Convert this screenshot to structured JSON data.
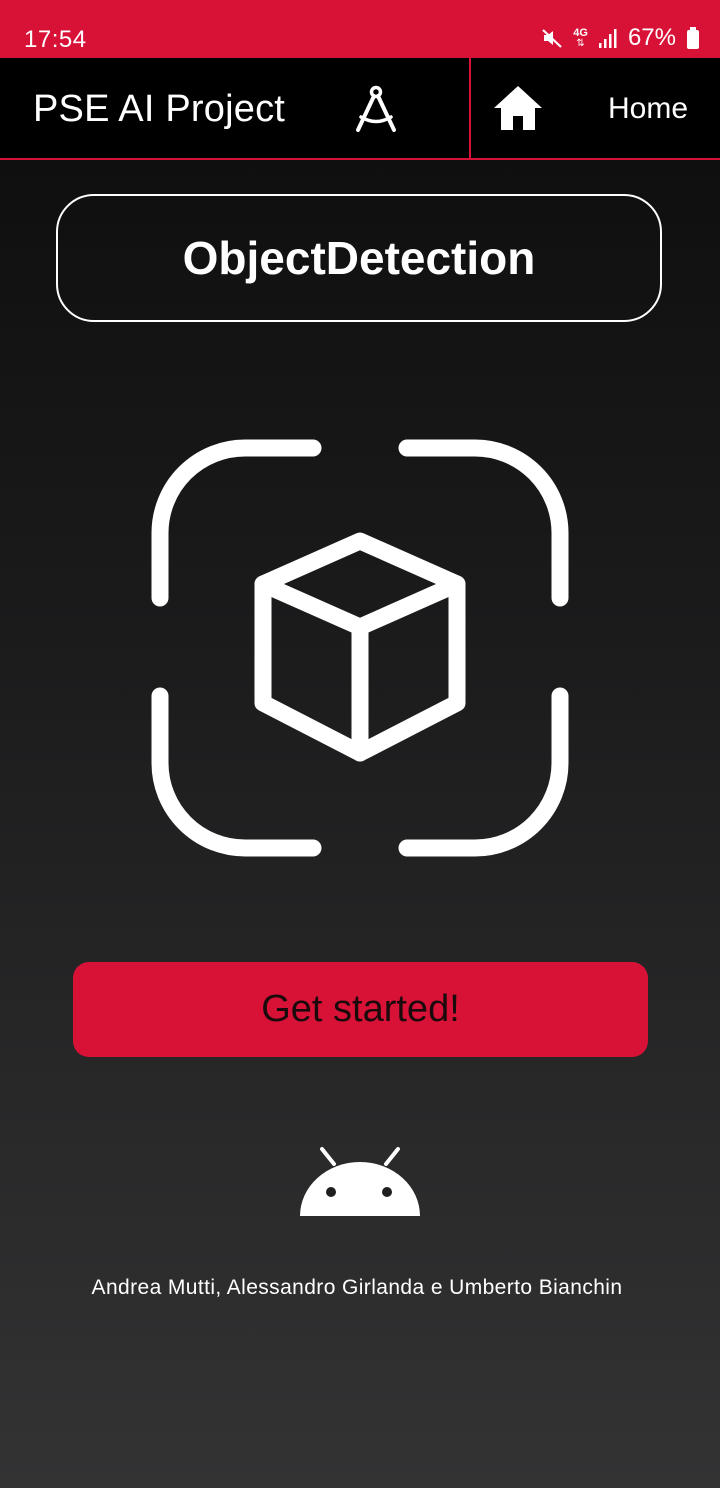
{
  "status_bar": {
    "time": "17:54",
    "network": "4G",
    "battery_percent": "67%",
    "icons": [
      "mute-icon",
      "4g-data-icon",
      "signal-icon",
      "battery-icon"
    ],
    "color": "#d81237"
  },
  "app_bar": {
    "title": "PSE AI Project",
    "title_icon": "compass-icon",
    "home_icon": "home-icon",
    "home_label": "Home",
    "background": "#000000",
    "accent": "#d81237"
  },
  "main": {
    "feature_title": "ObjectDetection",
    "graphic_icon": "object-detection-icon",
    "cta_label": "Get started!",
    "cta_color": "#d81237",
    "footer_icon": "android-icon",
    "credits": "Andrea Mutti, Alessandro Girlanda e Umberto Bianchin"
  }
}
